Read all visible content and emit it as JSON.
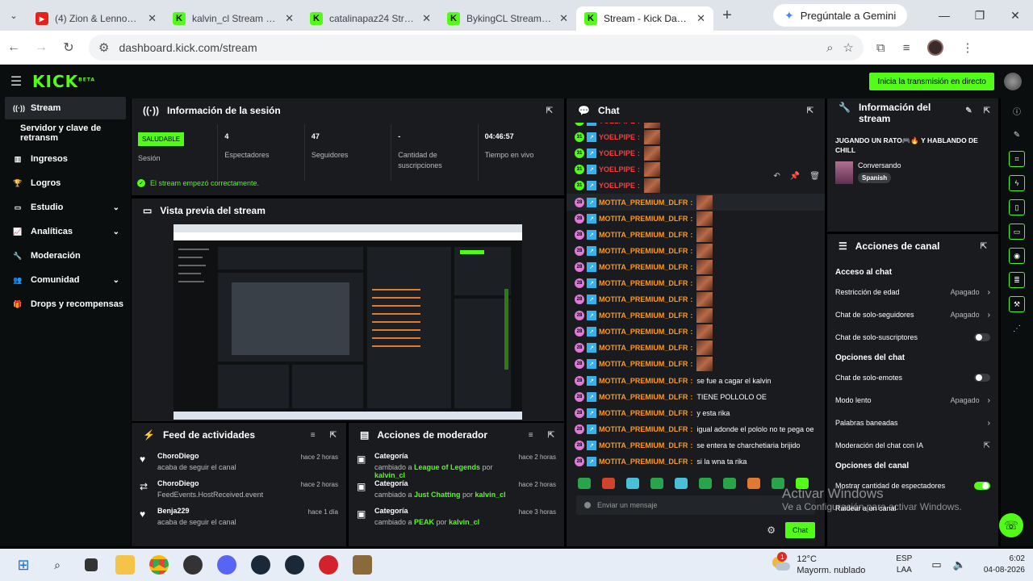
{
  "browser": {
    "tabs": [
      {
        "title": "(4) Zion & Lennox, A...",
        "favicon": "youtube",
        "active": false
      },
      {
        "title": "kalvin_cl Stream - W...",
        "favicon": "kick",
        "active": false
      },
      {
        "title": "catalinapaz24 Strean...",
        "favicon": "kick",
        "active": false
      },
      {
        "title": "BykingCL Stream - W...",
        "favicon": "kick",
        "active": false
      },
      {
        "title": "Stream - Kick Dashbo...",
        "favicon": "kick",
        "active": true
      }
    ],
    "gemini_label": "Pregúntale a Gemini",
    "url": "dashboard.kick.com/stream"
  },
  "header": {
    "logo": "KICK",
    "logo_sup": "BETA",
    "go_live": "Inicia la transmisión en directo"
  },
  "sidebar": {
    "items": [
      {
        "label": "Stream",
        "icon": "broadcast-icon",
        "active": true
      },
      {
        "label": "Servidor y clave de retransm",
        "sub": true
      },
      {
        "label": "Ingresos",
        "icon": "chart-icon"
      },
      {
        "label": "Logros",
        "icon": "trophy-icon"
      },
      {
        "label": "Estudio",
        "icon": "monitor-icon",
        "chevron": true
      },
      {
        "label": "Analíticas",
        "icon": "analytics-icon",
        "chevron": true
      },
      {
        "label": "Moderación",
        "icon": "wrench-icon"
      },
      {
        "label": "Comunidad",
        "icon": "people-icon",
        "chevron": true
      },
      {
        "label": "Drops y recompensas",
        "icon": "gift-icon"
      }
    ]
  },
  "session": {
    "title": "Información de la sesión",
    "status_badge": "SALUDABLE",
    "status_label": "Sesión",
    "viewers": "4",
    "viewers_label": "Espectadores",
    "followers": "47",
    "followers_label": "Seguidores",
    "subs": "-",
    "subs_label": "Cantidad de suscripciones",
    "uptime": "04:46:57",
    "uptime_label": "Tiempo en vivo",
    "ok_message": "El stream empezó correctamente."
  },
  "preview": {
    "title": "Vista previa del stream"
  },
  "feed": {
    "title": "Feed de actividades",
    "items": [
      {
        "name": "ChoroDiego",
        "desc": "acaba de seguir el canal",
        "time": "hace 2 horas",
        "icon": "heart-icon"
      },
      {
        "name": "ChoroDiego",
        "desc": "FeedEvents.HostReceived.event",
        "time": "hace 2 horas",
        "icon": "host-icon"
      },
      {
        "name": "Benja229",
        "desc": "acaba de seguir el canal",
        "time": "hace 1 día",
        "icon": "heart-icon"
      }
    ]
  },
  "modactions": {
    "title": "Acciones de moderador",
    "items": [
      {
        "title": "Categoría",
        "pre": "cambiado a ",
        "cat": "League of Legends",
        "mid": " por ",
        "by": "kalvin_cl",
        "time": "hace 2 horas"
      },
      {
        "title": "Categoría",
        "pre": "cambiado a ",
        "cat": "Just Chatting",
        "mid": " por ",
        "by": "kalvin_cl",
        "time": "hace 2 horas"
      },
      {
        "title": "Categoría",
        "pre": "cambiado a ",
        "cat": "PEAK",
        "mid": " por ",
        "by": "kalvin_cl",
        "time": "hace 3 horas"
      }
    ]
  },
  "chat": {
    "title": "Chat",
    "messages": [
      {
        "badge": "31",
        "user": "YOELPIPE",
        "color": "#ff3b3b",
        "emote": true,
        "text": ""
      },
      {
        "badge": "31",
        "user": "YOELPIPE",
        "color": "#ff3b3b",
        "emote": true,
        "text": ""
      },
      {
        "badge": "31",
        "user": "YOELPIPE",
        "color": "#ff3b3b",
        "emote": true,
        "text": ""
      },
      {
        "badge": "31",
        "user": "YOELPIPE",
        "color": "#ff3b3b",
        "emote": true,
        "text": ""
      },
      {
        "badge": "31",
        "user": "YOELPIPE",
        "color": "#ff3b3b",
        "emote": true,
        "text": ""
      },
      {
        "badge": "28",
        "user": "MOTITA_PREMIUM_DLFR",
        "color": "#ff9a1f",
        "emote": true,
        "text": "",
        "sub": true
      },
      {
        "badge": "28",
        "user": "MOTITA_PREMIUM_DLFR",
        "color": "#ff9a1f",
        "emote": true,
        "text": "",
        "sub": true
      },
      {
        "badge": "28",
        "user": "MOTITA_PREMIUM_DLFR",
        "color": "#ff9a1f",
        "emote": true,
        "text": "",
        "sub": true
      },
      {
        "badge": "28",
        "user": "MOTITA_PREMIUM_DLFR",
        "color": "#ff9a1f",
        "emote": true,
        "text": "",
        "sub": true
      },
      {
        "badge": "28",
        "user": "MOTITA_PREMIUM_DLFR",
        "color": "#ff9a1f",
        "emote": true,
        "text": "",
        "sub": true
      },
      {
        "badge": "28",
        "user": "MOTITA_PREMIUM_DLFR",
        "color": "#ff9a1f",
        "emote": true,
        "text": "",
        "sub": true
      },
      {
        "badge": "28",
        "user": "MOTITA_PREMIUM_DLFR",
        "color": "#ff9a1f",
        "emote": true,
        "text": "",
        "sub": true
      },
      {
        "badge": "28",
        "user": "MOTITA_PREMIUM_DLFR",
        "color": "#ff9a1f",
        "emote": true,
        "text": "",
        "sub": true
      },
      {
        "badge": "28",
        "user": "MOTITA_PREMIUM_DLFR",
        "color": "#ff9a1f",
        "emote": true,
        "text": "",
        "sub": true
      },
      {
        "badge": "28",
        "user": "MOTITA_PREMIUM_DLFR",
        "color": "#ff9a1f",
        "emote": true,
        "text": "",
        "sub": true
      },
      {
        "badge": "28",
        "user": "MOTITA_PREMIUM_DLFR",
        "color": "#ff9a1f",
        "emote": true,
        "text": "",
        "sub": true
      },
      {
        "badge": "28",
        "user": "MOTITA_PREMIUM_DLFR",
        "color": "#ff9a1f",
        "emote": false,
        "text": "se fue a cagar el kalvin",
        "sub": true
      },
      {
        "badge": "28",
        "user": "MOTITA_PREMIUM_DLFR",
        "color": "#ff9a1f",
        "emote": false,
        "text": "TIENE POLLOLO OE",
        "sub": true
      },
      {
        "badge": "28",
        "user": "MOTITA_PREMIUM_DLFR",
        "color": "#ff9a1f",
        "emote": false,
        "text": "y esta rika",
        "sub": true
      },
      {
        "badge": "28",
        "user": "MOTITA_PREMIUM_DLFR",
        "color": "#ff9a1f",
        "emote": false,
        "text": "igual adonde el pololo no te pega oe",
        "sub": true
      },
      {
        "badge": "28",
        "user": "MOTITA_PREMIUM_DLFR",
        "color": "#ff9a1f",
        "emote": false,
        "text": "se entera te charchetiaria brijido",
        "sub": true
      },
      {
        "badge": "28",
        "user": "MOTITA_PREMIUM_DLFR",
        "color": "#ff9a1f",
        "emote": false,
        "text": "si la wna ta rika",
        "sub": true
      }
    ],
    "input_placeholder": "Enviar un mensaje",
    "send_label": "Chat"
  },
  "streaminfo": {
    "title": "Información del stream",
    "stream_title": "JUGANDO UN RATO🎮🔥 Y HABLANDO DE CHILL",
    "category": "Conversando",
    "language": "Spanish"
  },
  "channel": {
    "title": "Acciones de canal",
    "sections": [
      {
        "heading": "Acceso al chat",
        "rows": [
          {
            "label": "Restricción de edad",
            "value": "Apagado",
            "type": "arrow"
          },
          {
            "label": "Chat de solo-seguidores",
            "value": "Apagado",
            "type": "arrow"
          },
          {
            "label": "Chat de solo-suscriptores",
            "type": "toggle",
            "on": false
          }
        ]
      },
      {
        "heading": "Opciones del chat",
        "rows": [
          {
            "label": "Chat de solo-emotes",
            "type": "toggle",
            "on": false
          },
          {
            "label": "Modo lento",
            "value": "Apagado",
            "type": "arrow"
          },
          {
            "label": "Palabras baneadas",
            "type": "arrow"
          },
          {
            "label": "Moderación del chat con IA",
            "type": "external"
          }
        ]
      },
      {
        "heading": "Opciones del canal",
        "rows": [
          {
            "label": "Mostrar cantidad de espectadores",
            "type": "toggle",
            "on": true
          },
          {
            "label": "Raidear a un canal",
            "type": "none"
          }
        ]
      }
    ]
  },
  "watermark": {
    "line1": "Activar Windows",
    "line2": "Ve a Configuración para activar Windows."
  },
  "taskbar": {
    "weather_badge": "1",
    "temp": "12°C",
    "weather_desc": "Mayorm. nublado",
    "lang1": "ESP",
    "lang2": "LAA",
    "time": "6:02",
    "date": "04-08-2026"
  },
  "colors": {
    "accent": "#53fc18",
    "panel": "#191b1f",
    "bg": "#0b0e0f"
  }
}
